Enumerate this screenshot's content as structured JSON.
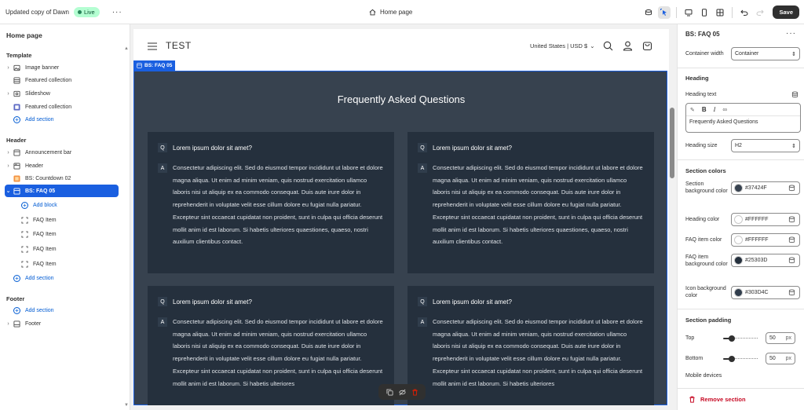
{
  "topbar": {
    "store_name": "Updated copy of Dawn",
    "live_label": "Live",
    "page_label": "Home page",
    "save_label": "Save"
  },
  "sidebar": {
    "title": "Home page",
    "template": {
      "title": "Template",
      "items": [
        "Image banner",
        "Featured collection",
        "Slideshow",
        "Featured collection"
      ],
      "add": "Add section"
    },
    "header": {
      "title": "Header",
      "items": [
        "Announcement bar",
        "Header",
        "BS: Countdown 02",
        "BS: FAQ 05"
      ],
      "add_block": "Add block",
      "blocks": [
        "FAQ Item",
        "FAQ Item",
        "FAQ Item",
        "FAQ Item"
      ],
      "add": "Add section"
    },
    "footer": {
      "title": "Footer",
      "add": "Add section",
      "items": [
        "Footer"
      ]
    }
  },
  "preview": {
    "logo": "TEST",
    "locale": "United States | USD $",
    "section_tag": "BS: FAQ 05",
    "heading": "Frequently Asked Questions",
    "q_badge": "Q",
    "a_badge": "A",
    "faqs": [
      {
        "question": "Lorem ipsum dolor sit amet?",
        "answer": "Consectetur adipiscing elit. Sed do eiusmod tempor incididunt ut labore et dolore magna aliqua. Ut enim ad minim veniam, quis nostrud exercitation ullamco laboris nisi ut aliquip ex ea commodo consequat. Duis aute irure dolor in reprehenderit in voluptate velit esse cillum dolore eu fugiat nulla pariatur. Excepteur sint occaecat cupidatat non proident, sunt in culpa qui officia deserunt mollit anim id est laborum. Si habetis ulteriores quaestiones, quaeso, nostri auxilium clientibus contact."
      },
      {
        "question": "Lorem ipsum dolor sit amet?",
        "answer": "Consectetur adipiscing elit. Sed do eiusmod tempor incididunt ut labore et dolore magna aliqua. Ut enim ad minim veniam, quis nostrud exercitation ullamco laboris nisi ut aliquip ex ea commodo consequat. Duis aute irure dolor in reprehenderit in voluptate velit esse cillum dolore eu fugiat nulla pariatur. Excepteur sint occaecat cupidatat non proident, sunt in culpa qui officia deserunt mollit anim id est laborum. Si habetis ulteriores quaestiones, quaeso, nostri auxilium clientibus contact."
      },
      {
        "question": "Lorem ipsum dolor sit amet?",
        "answer": "Consectetur adipiscing elit. Sed do eiusmod tempor incididunt ut labore et dolore magna aliqua. Ut enim ad minim veniam, quis nostrud exercitation ullamco laboris nisi ut aliquip ex ea commodo consequat. Duis aute irure dolor in reprehenderit in voluptate velit esse cillum dolore eu fugiat nulla pariatur. Excepteur sint occaecat cupidatat non proident, sunt in culpa qui officia deserunt mollit anim id est laborum. Si habetis ulteriores"
      },
      {
        "question": "Lorem ipsum dolor sit amet?",
        "answer": "Consectetur adipiscing elit. Sed do eiusmod tempor incididunt ut labore et dolore magna aliqua. Ut enim ad minim veniam, quis nostrud exercitation ullamco laboris nisi ut aliquip ex ea commodo consequat. Duis aute irure dolor in reprehenderit in voluptate velit esse cillum dolore eu fugiat nulla pariatur. Excepteur sint occaecat cupidatat non proident, sunt in culpa qui officia deserunt mollit anim id est laborum. Si habetis ulteriores"
      }
    ]
  },
  "settings": {
    "title": "BS: FAQ 05",
    "container_width": {
      "label": "Container width",
      "value": "Container"
    },
    "heading_group": "Heading",
    "heading_text": {
      "label": "Heading text",
      "value": "Frequently Asked Questions"
    },
    "heading_size": {
      "label": "Heading size",
      "value": "H2"
    },
    "colors_group": "Section colors",
    "colors": [
      {
        "label": "Section background color",
        "value": "#37424F"
      },
      {
        "label": "Heading color",
        "value": "#FFFFFF"
      },
      {
        "label": "FAQ item color",
        "value": "#FFFFFF"
      },
      {
        "label": "FAQ item background color",
        "value": "#25303D"
      },
      {
        "label": "Icon background color",
        "value": "#303D4C"
      }
    ],
    "padding_group": "Section padding",
    "padding_top": {
      "label": "Top",
      "value": "50",
      "unit": "px",
      "fraction": 0.25
    },
    "padding_bottom": {
      "label": "Bottom",
      "value": "50",
      "unit": "px",
      "fraction": 0.25
    },
    "mobile_label": "Mobile devices",
    "remove_label": "Remove section"
  },
  "theme_colors": {
    "selection": "#1A5FE0",
    "section_bg": "#37424F",
    "card_bg": "#25303D",
    "icon_bg": "#303D4C",
    "destructive": "#C70A24"
  }
}
